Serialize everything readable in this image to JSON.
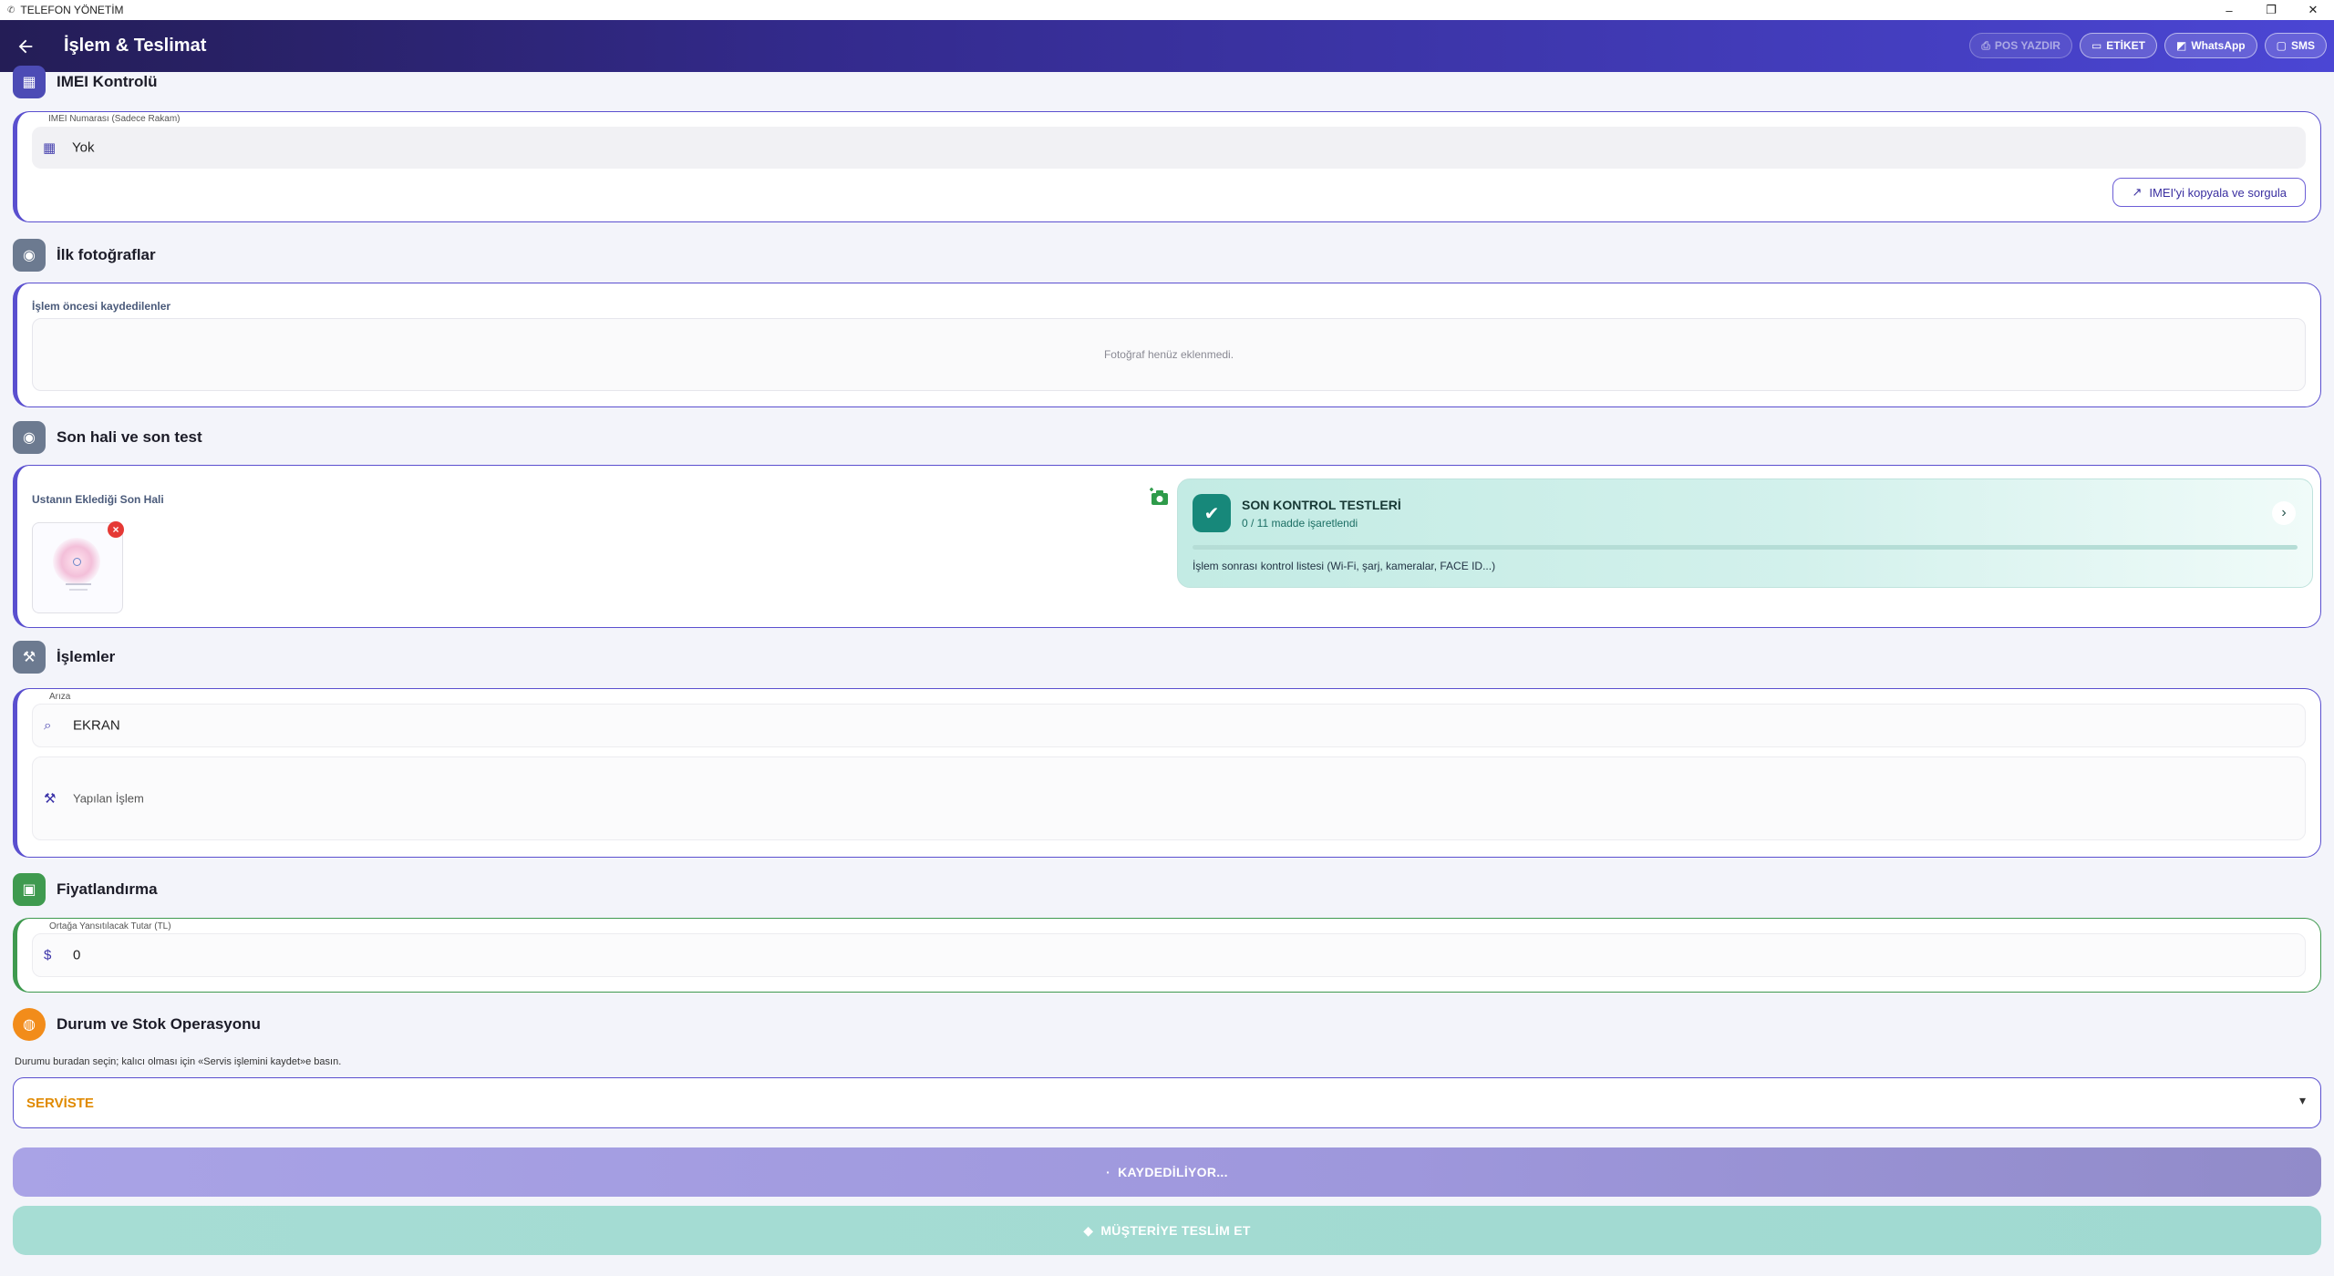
{
  "window": {
    "title": "TELEFON YÖNETİM",
    "minimize": "–",
    "maximize": "❐",
    "close": "✕"
  },
  "appbar": {
    "title": "İşlem & Teslimat",
    "back_icon": "arrow-left-icon",
    "actions": [
      {
        "label": "POS YAZDIR",
        "icon": "printer-icon",
        "enabled": false
      },
      {
        "label": "ETİKET",
        "icon": "label-icon",
        "enabled": true
      },
      {
        "label": "WhatsApp",
        "icon": "chat-icon",
        "enabled": true
      },
      {
        "label": "SMS",
        "icon": "sms-icon",
        "enabled": true
      }
    ]
  },
  "imei": {
    "section_title": "IMEI Kontrolü",
    "field_label": "IMEI Numarası (Sadece Rakam)",
    "value": "Yok",
    "action_label": "IMEI'yi kopyala ve sorgula",
    "accent": "#5a4fcf"
  },
  "photos_before": {
    "section_title": "İlk fotoğraflar",
    "subtitle": "İşlem öncesi kaydedilenler",
    "empty_text": "Fotoğraf henüz eklenmedi."
  },
  "final_state": {
    "section_title": "Son hali ve son test",
    "subtitle": "Ustanın Eklediği Son Hali",
    "photo_count": 1,
    "tests": {
      "title": "SON KONTROL TESTLERİ",
      "progress_text": "0 / 11 madde işaretlendi",
      "checked": 0,
      "total": 11,
      "note": "İşlem sonrası kontrol listesi (Wi-Fi, şarj, kameralar, FACE ID...)",
      "accent": "#17887a"
    }
  },
  "operations": {
    "section_title": "İşlemler",
    "fault_label": "Arıza",
    "fault_value": "EKRAN",
    "done_placeholder": "Yapılan İşlem"
  },
  "pricing": {
    "section_title": "Fiyatlandırma",
    "amount_label": "Ortağa Yansıtılacak Tutar (TL)",
    "amount_value": "0",
    "accent": "#3f9a4f"
  },
  "status": {
    "section_title": "Durum ve Stok Operasyonu",
    "helper": "Durumu buradan seçin; kalıcı olması için «Servis işlemini kaydet»e basın.",
    "selected": "SERVİSTE",
    "selected_color": "#e08a00"
  },
  "buttons": {
    "save_label": "KAYDEDİLİYOR...",
    "deliver_label": "MÜŞTERİYE TESLİM ET"
  }
}
